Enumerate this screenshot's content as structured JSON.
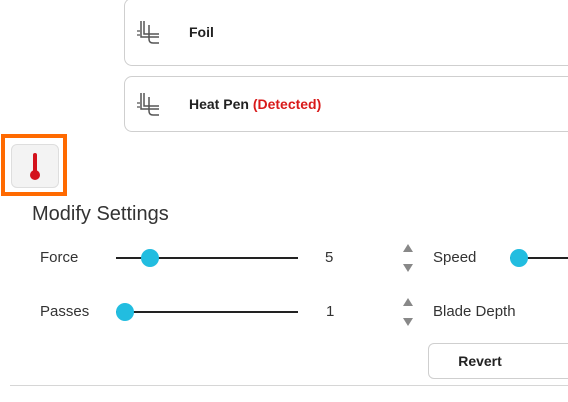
{
  "tools": [
    {
      "label": "Foil",
      "status": "",
      "icon": "foil-tool-icon"
    },
    {
      "label": "Heat Pen",
      "status": "(Detected)",
      "icon": "heat-pen-tool-icon"
    }
  ],
  "selected_tool_icon": "thermometer-icon",
  "settings": {
    "title": "Modify Settings",
    "force": {
      "label": "Force",
      "value": "5",
      "level": 0.15
    },
    "speed": {
      "label": "Speed",
      "level": 0.0
    },
    "passes": {
      "label": "Passes",
      "value": "1",
      "level": 0.0
    },
    "blade_depth": {
      "label": "Blade Depth"
    }
  },
  "buttons": {
    "revert": "Revert"
  },
  "colors": {
    "highlight": "#ff6a00",
    "slider_thumb": "#22bde0",
    "detected": "#d91a1a",
    "thermometer": "#d3121c"
  }
}
